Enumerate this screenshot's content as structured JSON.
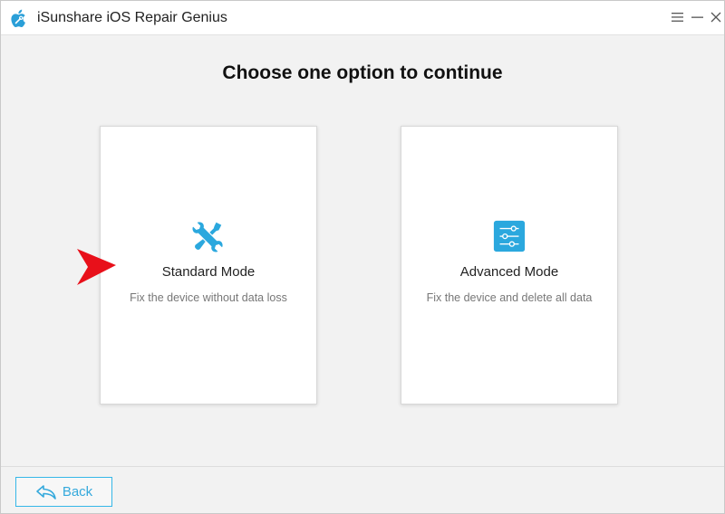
{
  "window": {
    "title": "iSunshare iOS Repair Genius"
  },
  "main": {
    "heading": "Choose one option to continue",
    "options": [
      {
        "title": "Standard Mode",
        "description": "Fix the device without data loss",
        "icon": "wrench-screwdriver-icon"
      },
      {
        "title": "Advanced Mode",
        "description": "Fix the device and delete all data",
        "icon": "sliders-icon"
      }
    ]
  },
  "footer": {
    "back_label": "Back"
  },
  "colors": {
    "accent": "#35b7e8",
    "pointer": "#e8101a"
  }
}
